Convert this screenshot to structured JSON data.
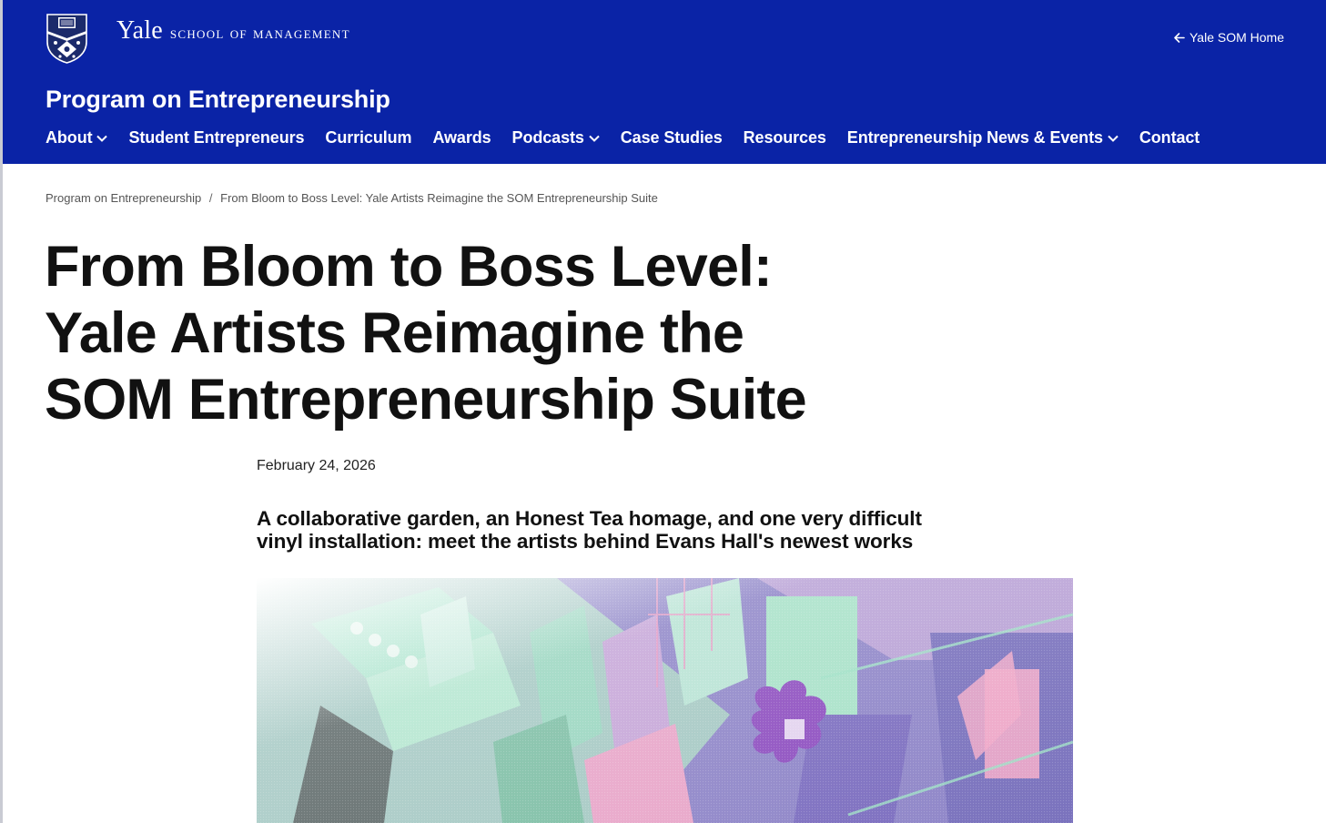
{
  "header": {
    "brand_yale": "Yale",
    "brand_school": "School of Management",
    "home_link": "Yale SOM Home",
    "program_title": "Program on Entrepreneurship"
  },
  "nav": [
    {
      "label": "About",
      "dropdown": true
    },
    {
      "label": "Student Entrepreneurs",
      "dropdown": false
    },
    {
      "label": "Curriculum",
      "dropdown": false
    },
    {
      "label": "Awards",
      "dropdown": false
    },
    {
      "label": "Podcasts",
      "dropdown": true
    },
    {
      "label": "Case Studies",
      "dropdown": false
    },
    {
      "label": "Resources",
      "dropdown": false
    },
    {
      "label": "Entrepreneurship News & Events",
      "dropdown": true
    },
    {
      "label": "Contact",
      "dropdown": false
    }
  ],
  "breadcrumb": {
    "parent": "Program on Entrepreneurship",
    "separator": "/",
    "current": "From Bloom to Boss Level: Yale Artists Reimagine the SOM Entrepreneurship Suite"
  },
  "article": {
    "headline_line1": "From Bloom to Boss Level:",
    "headline_line2": "Yale Artists Reimagine the",
    "headline_line3": "SOM Entrepreneurship Suite",
    "date": "February 24, 2026",
    "dek_line1": "A collaborative garden, an Honest Tea homage, and one very difficult",
    "dek_line2": "vinyl installation: meet the artists behind Evans Hall's newest works"
  },
  "colors": {
    "header_bg": "#0A23A6",
    "text": "#111111",
    "hero_purple": "#8E4FC0",
    "hero_mint": "#9FE0C6",
    "hero_pink": "#E79AC4"
  },
  "icons": {
    "shield": "yale-shield-icon",
    "home_arrow": "arrow-left-icon",
    "dropdown": "chevron-down-icon"
  }
}
